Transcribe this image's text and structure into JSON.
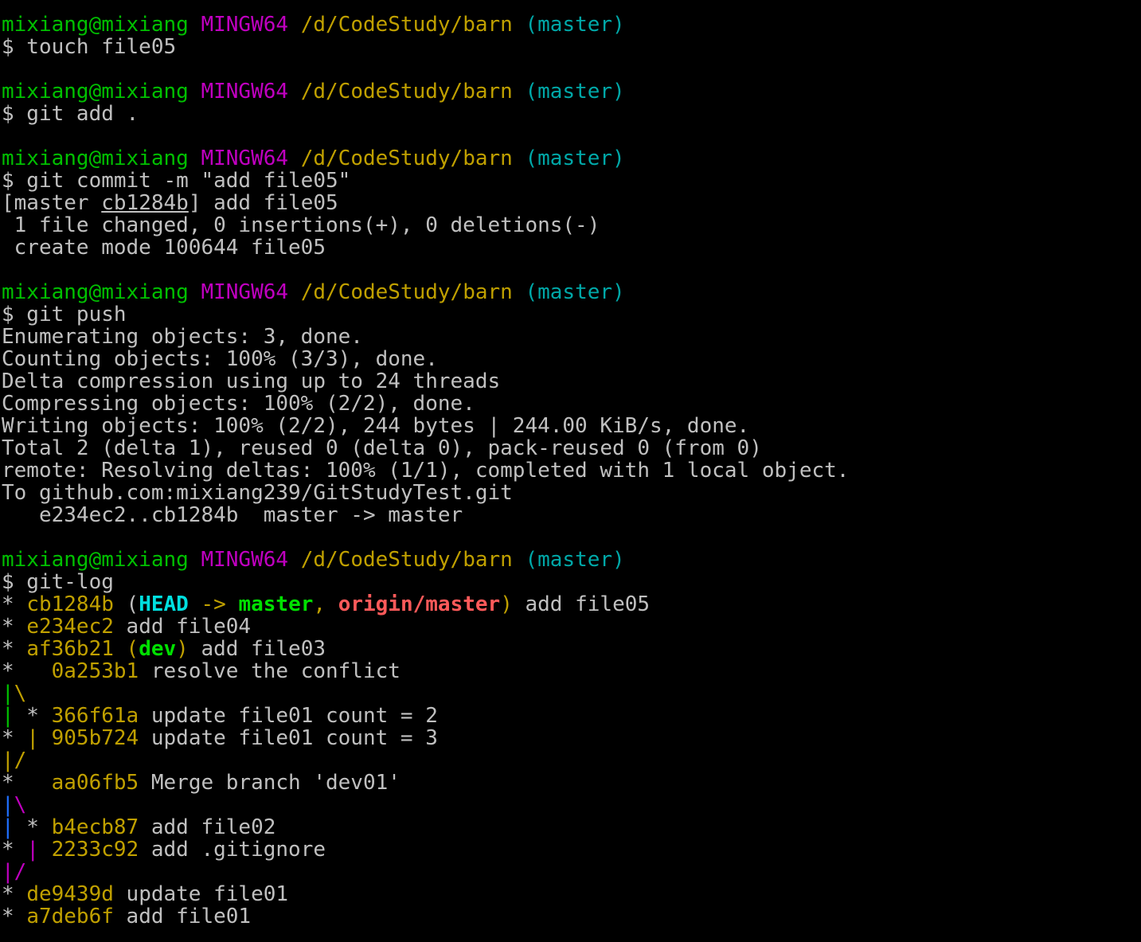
{
  "terminal": {
    "lines": [
      [
        {
          "t": "mixiang@mixiang",
          "c": "#00c000"
        },
        {
          "t": " "
        },
        {
          "t": "MINGW64",
          "c": "#c000c0"
        },
        {
          "t": " "
        },
        {
          "t": "/d/CodeStudy/barn",
          "c": "#c0a000"
        },
        {
          "t": " "
        },
        {
          "t": "(master)",
          "c": "#00a8a8"
        }
      ],
      [
        {
          "t": "$ touch file05"
        }
      ],
      [],
      [
        {
          "t": "mixiang@mixiang",
          "c": "#00c000"
        },
        {
          "t": " "
        },
        {
          "t": "MINGW64",
          "c": "#c000c0"
        },
        {
          "t": " "
        },
        {
          "t": "/d/CodeStudy/barn",
          "c": "#c0a000"
        },
        {
          "t": " "
        },
        {
          "t": "(master)",
          "c": "#00a8a8"
        }
      ],
      [
        {
          "t": "$ git add ."
        }
      ],
      [],
      [
        {
          "t": "mixiang@mixiang",
          "c": "#00c000"
        },
        {
          "t": " "
        },
        {
          "t": "MINGW64",
          "c": "#c000c0"
        },
        {
          "t": " "
        },
        {
          "t": "/d/CodeStudy/barn",
          "c": "#c0a000"
        },
        {
          "t": " "
        },
        {
          "t": "(master)",
          "c": "#00a8a8"
        }
      ],
      [
        {
          "t": "$ git commit -m \"add file05\""
        }
      ],
      [
        {
          "t": "[master "
        },
        {
          "t": "cb1284b",
          "u": true
        },
        {
          "t": "] add file05"
        }
      ],
      [
        {
          "t": " 1 file changed, 0 insertions(+), 0 deletions(-)"
        }
      ],
      [
        {
          "t": " create mode 100644 file05"
        }
      ],
      [],
      [
        {
          "t": "mixiang@mixiang",
          "c": "#00c000"
        },
        {
          "t": " "
        },
        {
          "t": "MINGW64",
          "c": "#c000c0"
        },
        {
          "t": " "
        },
        {
          "t": "/d/CodeStudy/barn",
          "c": "#c0a000"
        },
        {
          "t": " "
        },
        {
          "t": "(master)",
          "c": "#00a8a8"
        }
      ],
      [
        {
          "t": "$ git push"
        }
      ],
      [
        {
          "t": "Enumerating objects: 3, done."
        }
      ],
      [
        {
          "t": "Counting objects: 100% (3/3), done."
        }
      ],
      [
        {
          "t": "Delta compression using up to 24 threads"
        }
      ],
      [
        {
          "t": "Compressing objects: 100% (2/2), done."
        }
      ],
      [
        {
          "t": "Writing objects: 100% (2/2), 244 bytes | 244.00 KiB/s, done."
        }
      ],
      [
        {
          "t": "Total 2 (delta 1), reused 0 (delta 0), pack-reused 0 (from 0)"
        }
      ],
      [
        {
          "t": "remote: Resolving deltas: 100% (1/1), completed with 1 local object."
        }
      ],
      [
        {
          "t": "To github.com:mixiang239/GitStudyTest.git"
        }
      ],
      [
        {
          "t": "   e234ec2..cb1284b  master -> master"
        }
      ],
      [],
      [
        {
          "t": "mixiang@mixiang",
          "c": "#00c000"
        },
        {
          "t": " "
        },
        {
          "t": "MINGW64",
          "c": "#c000c0"
        },
        {
          "t": " "
        },
        {
          "t": "/d/CodeStudy/barn",
          "c": "#c0a000"
        },
        {
          "t": " "
        },
        {
          "t": "(master)",
          "c": "#00a8a8"
        }
      ],
      [
        {
          "t": "$ git-log"
        }
      ],
      [
        {
          "t": "* "
        },
        {
          "t": "cb1284b",
          "c": "#c0a000"
        },
        {
          "t": " ("
        },
        {
          "t": "HEAD",
          "c": "#00e0e0",
          "b": true
        },
        {
          "t": " -> ",
          "c": "#c0a000"
        },
        {
          "t": "master",
          "c": "#00e000",
          "b": true
        },
        {
          "t": ", ",
          "c": "#c0a000"
        },
        {
          "t": "origin/master",
          "c": "#ff5a5a",
          "b": true
        },
        {
          "t": ")",
          "c": "#c0a000"
        },
        {
          "t": " add file05"
        }
      ],
      [
        {
          "t": "* "
        },
        {
          "t": "e234ec2",
          "c": "#c0a000"
        },
        {
          "t": " add file04"
        }
      ],
      [
        {
          "t": "* "
        },
        {
          "t": "af36b21",
          "c": "#c0a000"
        },
        {
          "t": " (",
          "c": "#c0a000"
        },
        {
          "t": "dev",
          "c": "#00e000",
          "b": true
        },
        {
          "t": ")",
          "c": "#c0a000"
        },
        {
          "t": " add file03"
        }
      ],
      [
        {
          "t": "*   "
        },
        {
          "t": "0a253b1",
          "c": "#c0a000"
        },
        {
          "t": " resolve the conflict"
        }
      ],
      [
        {
          "t": "|",
          "c": "#00c000"
        },
        {
          "t": "\\",
          "c": "#c0a000"
        }
      ],
      [
        {
          "t": "|",
          "c": "#00c000"
        },
        {
          "t": " * "
        },
        {
          "t": "366f61a",
          "c": "#c0a000"
        },
        {
          "t": " update file01 count = 2"
        }
      ],
      [
        {
          "t": "* "
        },
        {
          "t": "|",
          "c": "#c0a000"
        },
        {
          "t": " "
        },
        {
          "t": "905b724",
          "c": "#c0a000"
        },
        {
          "t": " update file01 count = 3"
        }
      ],
      [
        {
          "t": "|",
          "c": "#c0a000"
        },
        {
          "t": "/",
          "c": "#c0a000"
        }
      ],
      [
        {
          "t": "*   "
        },
        {
          "t": "aa06fb5",
          "c": "#c0a000"
        },
        {
          "t": " Merge branch 'dev01'"
        }
      ],
      [
        {
          "t": "|",
          "c": "#2070ff"
        },
        {
          "t": "\\",
          "c": "#c000c0"
        }
      ],
      [
        {
          "t": "|",
          "c": "#2070ff"
        },
        {
          "t": " * "
        },
        {
          "t": "b4ecb87",
          "c": "#c0a000"
        },
        {
          "t": " add file02"
        }
      ],
      [
        {
          "t": "* "
        },
        {
          "t": "|",
          "c": "#c000c0"
        },
        {
          "t": " "
        },
        {
          "t": "2233c92",
          "c": "#c0a000"
        },
        {
          "t": " add .gitignore"
        }
      ],
      [
        {
          "t": "|",
          "c": "#c000c0"
        },
        {
          "t": "/",
          "c": "#c000c0"
        }
      ],
      [
        {
          "t": "* "
        },
        {
          "t": "de9439d",
          "c": "#c0a000"
        },
        {
          "t": " update file01"
        }
      ],
      [
        {
          "t": "* "
        },
        {
          "t": "a7deb6f",
          "c": "#c0a000"
        },
        {
          "t": " add file01"
        }
      ]
    ]
  }
}
